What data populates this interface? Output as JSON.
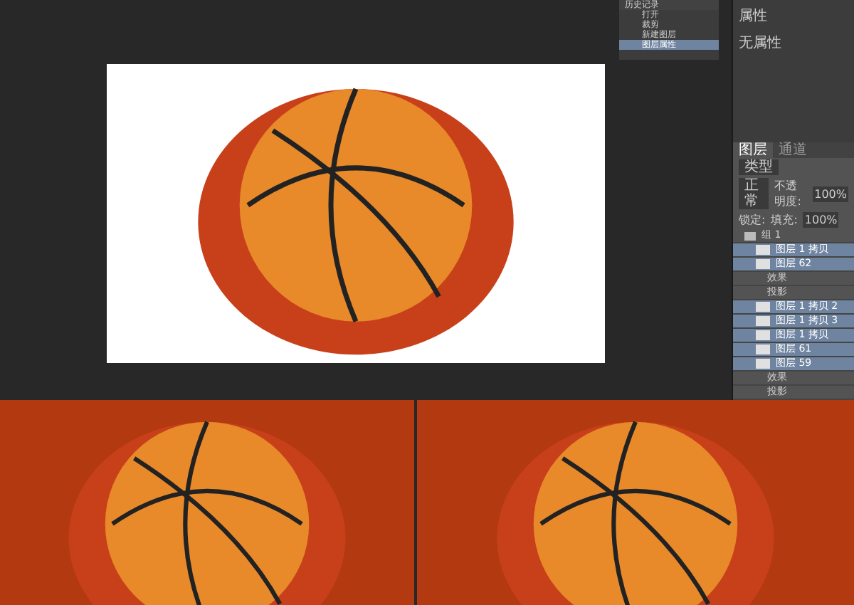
{
  "history_panel": {
    "title": "历史记录",
    "items": [
      {
        "label": "打开",
        "selected": false
      },
      {
        "label": "裁剪",
        "selected": false
      },
      {
        "label": "新建图层",
        "selected": false
      },
      {
        "label": "图层属性",
        "selected": true
      }
    ]
  },
  "properties_panel": {
    "title": "属性",
    "message": "无属性"
  },
  "layers_panel": {
    "tabs": [
      {
        "label": "图层",
        "selected": true
      },
      {
        "label": "通道",
        "selected": false
      }
    ],
    "filter": "类型",
    "blend_mode": "正常",
    "opacity_label": "不透明度:",
    "opacity": "100%",
    "lock_label": "锁定:",
    "fill_label": "填充:",
    "fill": "100%",
    "layers": [
      {
        "kind": "group",
        "label": "组 1",
        "selected": false
      },
      {
        "kind": "layer",
        "label": "图层 1 拷贝",
        "selected": true
      },
      {
        "kind": "layer",
        "label": "图层 62",
        "selected": true
      },
      {
        "kind": "effect",
        "label": "效果",
        "selected": false
      },
      {
        "kind": "effect",
        "label": "投影",
        "selected": false
      },
      {
        "kind": "layer",
        "label": "图层 1 拷贝 2",
        "selected": true
      },
      {
        "kind": "layer",
        "label": "图层 1 拷贝 3",
        "selected": true
      },
      {
        "kind": "layer",
        "label": "图层 1 拷贝",
        "selected": true
      },
      {
        "kind": "layer",
        "label": "图层 61",
        "selected": true
      },
      {
        "kind": "layer",
        "label": "图层 59",
        "selected": true
      },
      {
        "kind": "effect",
        "label": "效果",
        "selected": false
      },
      {
        "kind": "effect",
        "label": "投影",
        "selected": false
      }
    ]
  }
}
